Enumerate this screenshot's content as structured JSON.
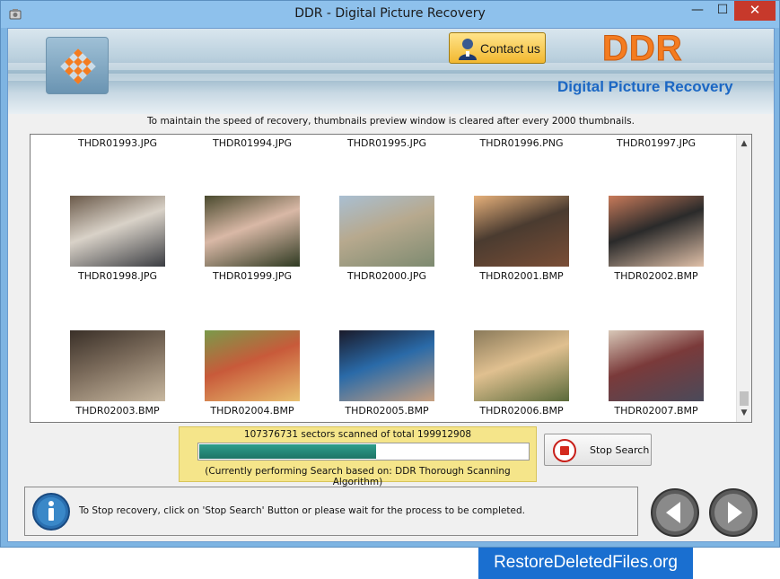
{
  "window": {
    "title": "DDR - Digital Picture Recovery",
    "minimize_glyph": "—",
    "maximize_glyph": "☐",
    "close_glyph": "✕"
  },
  "banner": {
    "contact_label": "Contact us",
    "brand": "DDR",
    "brand_subtitle": "Digital Picture Recovery",
    "brand_color": "#f47c20",
    "subtitle_color": "#1b67c4"
  },
  "notice": "To maintain the speed of recovery, thumbnails preview window is cleared after every 2000 thumbnails.",
  "thumbnails": {
    "rows": [
      {
        "items": [
          {
            "name": "THDR01993.JPG",
            "has_image": false
          },
          {
            "name": "THDR01994.JPG",
            "has_image": false
          },
          {
            "name": "THDR01995.JPG",
            "has_image": false
          },
          {
            "name": "THDR01996.PNG",
            "has_image": false
          },
          {
            "name": "THDR01997.JPG",
            "has_image": false
          }
        ]
      },
      {
        "items": [
          {
            "name": "THDR01998.JPG",
            "has_image": true,
            "colors": [
              "#6b5a4a",
              "#d9d2c8",
              "#3b3d42"
            ]
          },
          {
            "name": "THDR01999.JPG",
            "has_image": true,
            "colors": [
              "#4a4a2e",
              "#d9b8a6",
              "#2f3a22"
            ]
          },
          {
            "name": "THDR02000.JPG",
            "has_image": true,
            "colors": [
              "#a9bfd2",
              "#b7a98e",
              "#7d8a70"
            ]
          },
          {
            "name": "THDR02001.BMP",
            "has_image": true,
            "colors": [
              "#e6b07a",
              "#4a3b30",
              "#7a4e36"
            ]
          },
          {
            "name": "THDR02002.BMP",
            "has_image": true,
            "colors": [
              "#c87a5a",
              "#2a2a2a",
              "#e0c0a8"
            ]
          }
        ]
      },
      {
        "items": [
          {
            "name": "THDR02003.BMP",
            "has_image": true,
            "colors": [
              "#3a3028",
              "#7a6a5a",
              "#c8b8a0"
            ]
          },
          {
            "name": "THDR02004.BMP",
            "has_image": true,
            "colors": [
              "#7a9a4a",
              "#c85a3a",
              "#e8c070"
            ]
          },
          {
            "name": "THDR02005.BMP",
            "has_image": true,
            "colors": [
              "#1a1a2a",
              "#2a6aa8",
              "#c8a080"
            ]
          },
          {
            "name": "THDR02006.BMP",
            "has_image": true,
            "colors": [
              "#8a7a5a",
              "#e0c090",
              "#5a6a3a"
            ]
          },
          {
            "name": "THDR02007.BMP",
            "has_image": true,
            "colors": [
              "#d8c8b8",
              "#7a3a3a",
              "#4a4a5a"
            ]
          }
        ]
      }
    ]
  },
  "progress": {
    "scan_text": "107376731 sectors scanned of total 199912908",
    "fraction": 0.537,
    "algorithm_text": "(Currently performing Search based on:  DDR Thorough Scanning Algorithm)"
  },
  "stop_button": {
    "label": "Stop Search"
  },
  "status": {
    "message": "To Stop recovery, click on 'Stop Search' Button or please wait for the process to be completed."
  },
  "watermark": "RestoreDeletedFiles.org"
}
